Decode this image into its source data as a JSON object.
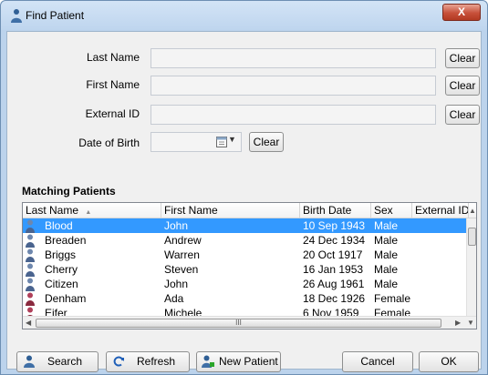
{
  "window": {
    "title": "Find Patient",
    "close_label": "X"
  },
  "fields": {
    "last_name_label": "Last Name",
    "first_name_label": "First Name",
    "external_id_label": "External ID",
    "dob_label": "Date of Birth",
    "clear_label": "Clear"
  },
  "matching": {
    "title": "Matching Patients",
    "columns": [
      "Last Name",
      "First Name",
      "Birth Date",
      "Sex",
      "External ID"
    ],
    "sort_indicator": "▲",
    "rows": [
      {
        "last": "Blood",
        "first": "John",
        "dob": "10 Sep 1943",
        "sex": "Male",
        "icon": "person-male-icon",
        "selected": true
      },
      {
        "last": "Breaden",
        "first": "Andrew",
        "dob": "24 Dec 1934",
        "sex": "Male",
        "icon": "person-male-icon"
      },
      {
        "last": "Briggs",
        "first": "Warren",
        "dob": "20 Oct 1917",
        "sex": "Male",
        "icon": "person-male-icon"
      },
      {
        "last": "Cherry",
        "first": "Steven",
        "dob": "16 Jan 1953",
        "sex": "Male",
        "icon": "person-male-icon"
      },
      {
        "last": "Citizen",
        "first": "John",
        "dob": "26 Aug 1961",
        "sex": "Male",
        "icon": "person-male-icon"
      },
      {
        "last": "Denham",
        "first": "Ada",
        "dob": "18 Dec 1926",
        "sex": "Female",
        "icon": "person-female-icon"
      },
      {
        "last": "Eifer",
        "first": "Michele",
        "dob": "6 Nov 1959",
        "sex": "Female",
        "icon": "person-female-icon"
      }
    ],
    "hscroll_grip": "III"
  },
  "buttons": {
    "search": "Search",
    "refresh": "Refresh",
    "new_patient": "New Patient",
    "cancel": "Cancel",
    "ok": "OK"
  },
  "colors": {
    "selection": "#3399ff",
    "title_bar": "#bed5ee",
    "close": "#c7503a"
  }
}
